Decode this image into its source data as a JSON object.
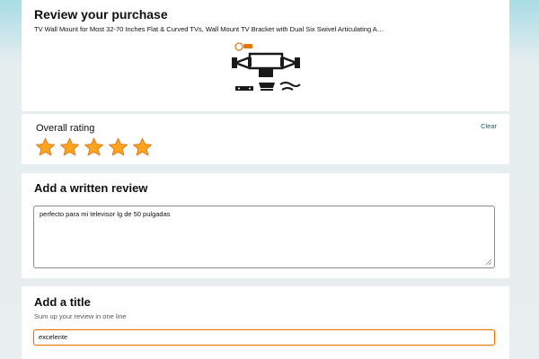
{
  "purchase": {
    "heading": "Review your purchase",
    "product_name": "TV Wall Mount for Most 32-70 Inches Flat & Curved TVs, Wall Mount TV Bracket with Dual Six Swivel Articulating A…"
  },
  "rating": {
    "label": "Overall rating",
    "clear_label": "Clear",
    "value": 5,
    "max": 5,
    "star_color": "#ffa41c"
  },
  "review": {
    "heading": "Add a written review",
    "text": "perfecto para mi televisor lg de 50 pulgadas"
  },
  "title_section": {
    "heading": "Add a title",
    "subtitle": "Sum up your review in one line",
    "value": "excelente"
  },
  "colors": {
    "link": "#007185",
    "focus_border": "#e77600"
  }
}
